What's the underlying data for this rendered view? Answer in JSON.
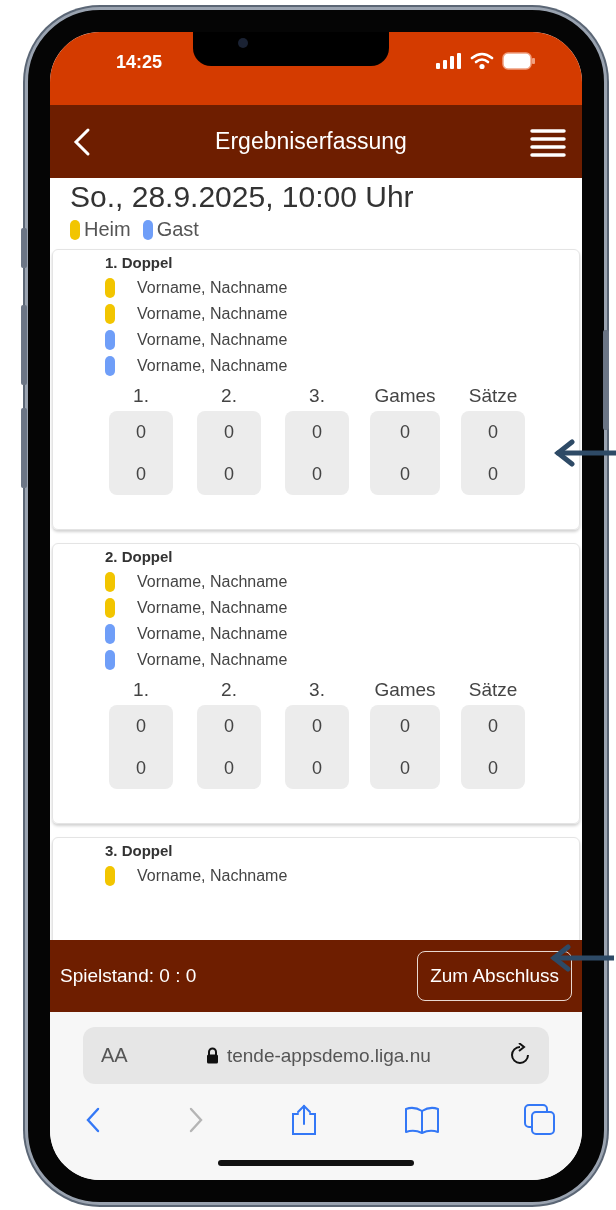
{
  "status_bar": {
    "time": "14:25"
  },
  "app_bar": {
    "title": "Ergebniserfassung"
  },
  "match": {
    "date": "So., 28.9.2025, 10:00 Uhr"
  },
  "legend": [
    {
      "label": "Heim",
      "color": "#f2c500"
    },
    {
      "label": "Gast",
      "color": "#6f9ef8"
    }
  ],
  "matches": [
    {
      "title": "1. Doppel",
      "players": [
        {
          "name": "Vorname, Nachname",
          "color": "#f2c500"
        },
        {
          "name": "Vorname, Nachname",
          "color": "#f2c500"
        },
        {
          "name": "Vorname, Nachname",
          "color": "#6f9ef8"
        },
        {
          "name": "Vorname, Nachname",
          "color": "#6f9ef8"
        }
      ],
      "score_columns": [
        {
          "label": "1.",
          "home": "0",
          "guest": "0"
        },
        {
          "label": "2.",
          "home": "0",
          "guest": "0"
        },
        {
          "label": "3.",
          "home": "0",
          "guest": "0"
        },
        {
          "label": "Games",
          "home": "0",
          "guest": "0"
        },
        {
          "label": "Sätze",
          "home": "0",
          "guest": "0"
        }
      ]
    },
    {
      "title": "2. Doppel",
      "players": [
        {
          "name": "Vorname, Nachname",
          "color": "#f2c500"
        },
        {
          "name": "Vorname, Nachname",
          "color": "#f2c500"
        },
        {
          "name": "Vorname, Nachname",
          "color": "#6f9ef8"
        },
        {
          "name": "Vorname, Nachname",
          "color": "#6f9ef8"
        }
      ],
      "score_columns": [
        {
          "label": "1.",
          "home": "0",
          "guest": "0"
        },
        {
          "label": "2.",
          "home": "0",
          "guest": "0"
        },
        {
          "label": "3.",
          "home": "0",
          "guest": "0"
        },
        {
          "label": "Games",
          "home": "0",
          "guest": "0"
        },
        {
          "label": "Sätze",
          "home": "0",
          "guest": "0"
        }
      ]
    },
    {
      "title": "3. Doppel",
      "players": [
        {
          "name": "Vorname, Nachname",
          "color": "#f2c500"
        }
      ]
    }
  ],
  "footer": {
    "score": "Spielstand: 0 : 0",
    "button": "Zum Abschluss"
  },
  "browser": {
    "text_size": "AA",
    "url": "tende-appsdemo.liga.nu",
    "nav": [
      {
        "kind": "back",
        "disabled": false
      },
      {
        "kind": "forward",
        "disabled": true
      },
      {
        "kind": "share",
        "disabled": false
      },
      {
        "kind": "bookmarks",
        "disabled": false
      },
      {
        "kind": "tabs",
        "disabled": false
      }
    ]
  }
}
